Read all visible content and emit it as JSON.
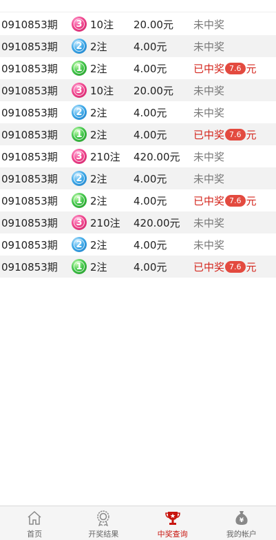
{
  "records": [
    {
      "period": "0910853期",
      "ball": "3",
      "ball_color": "pink",
      "count": "10注",
      "amount": "20.00元",
      "status": "未中奖",
      "won": false
    },
    {
      "period": "0910853期",
      "ball": "2",
      "ball_color": "blue",
      "count": "2注",
      "amount": "4.00元",
      "status": "未中奖",
      "won": false
    },
    {
      "period": "0910853期",
      "ball": "1",
      "ball_color": "green",
      "count": "2注",
      "amount": "4.00元",
      "status": "已中奖",
      "prize": "7.6",
      "prize_unit": "元",
      "won": true
    },
    {
      "period": "0910853期",
      "ball": "3",
      "ball_color": "pink",
      "count": "10注",
      "amount": "20.00元",
      "status": "未中奖",
      "won": false
    },
    {
      "period": "0910853期",
      "ball": "2",
      "ball_color": "blue",
      "count": "2注",
      "amount": "4.00元",
      "status": "未中奖",
      "won": false
    },
    {
      "period": "0910853期",
      "ball": "1",
      "ball_color": "green",
      "count": "2注",
      "amount": "4.00元",
      "status": "已中奖",
      "prize": "7.6",
      "prize_unit": "元",
      "won": true
    },
    {
      "period": "0910853期",
      "ball": "3",
      "ball_color": "pink",
      "count": "210注",
      "amount": "420.00元",
      "status": "未中奖",
      "won": false
    },
    {
      "period": "0910853期",
      "ball": "2",
      "ball_color": "blue",
      "count": "2注",
      "amount": "4.00元",
      "status": "未中奖",
      "won": false
    },
    {
      "period": "0910853期",
      "ball": "1",
      "ball_color": "green",
      "count": "2注",
      "amount": "4.00元",
      "status": "已中奖",
      "prize": "7.6",
      "prize_unit": "元",
      "won": true
    },
    {
      "period": "0910853期",
      "ball": "3",
      "ball_color": "pink",
      "count": "210注",
      "amount": "420.00元",
      "status": "未中奖",
      "won": false
    },
    {
      "period": "0910853期",
      "ball": "2",
      "ball_color": "blue",
      "count": "2注",
      "amount": "4.00元",
      "status": "未中奖",
      "won": false
    },
    {
      "period": "0910853期",
      "ball": "1",
      "ball_color": "green",
      "count": "2注",
      "amount": "4.00元",
      "status": "已中奖",
      "prize": "7.6",
      "prize_unit": "元",
      "won": true
    }
  ],
  "tabbar": {
    "items": [
      {
        "label": "首页",
        "icon": "home-icon",
        "active": false
      },
      {
        "label": "开奖结果",
        "icon": "medal-icon",
        "active": false
      },
      {
        "label": "中奖查询",
        "icon": "trophy-icon",
        "active": true
      },
      {
        "label": "我的帐户",
        "icon": "money-bag-icon",
        "active": false
      }
    ]
  },
  "colors": {
    "win": "#d4261d",
    "lose": "#777777",
    "active_tab": "#c8150e",
    "badge": "#e34a3f"
  }
}
